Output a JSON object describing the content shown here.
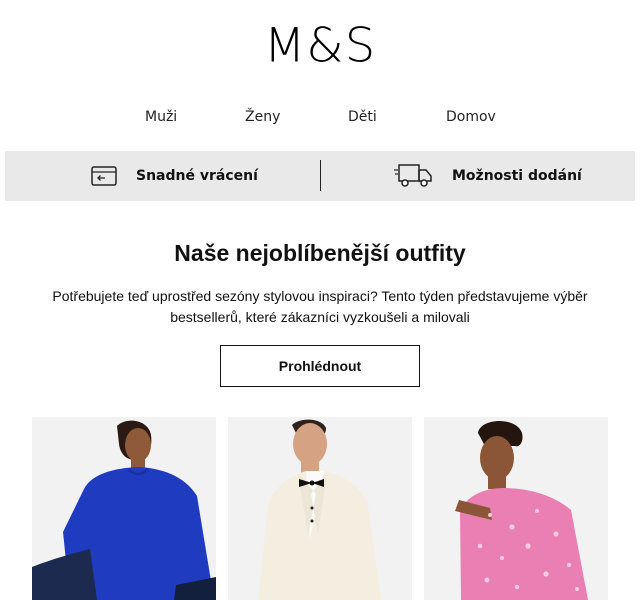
{
  "brand": {
    "logo_text": "M&S"
  },
  "nav": {
    "items": [
      "Muži",
      "Ženy",
      "Děti",
      "Domov"
    ]
  },
  "benefits": {
    "returns_label": "Snadné vrácení",
    "delivery_label": "Možnosti dodání"
  },
  "hero": {
    "title": "Naše nejoblíbenější outfity",
    "body": "Potřebujete teď uprostřed sezóny stylovou inspiraci? Tento týden představujeme výběr bestsellerů, které zákazníci vyzkoušeli a milovali",
    "cta_label": "Prohlédnout"
  },
  "products": [
    {
      "name": "woman-blue-top",
      "colors": {
        "garment": "#1f3bc0",
        "background": "#f2f2f2"
      }
    },
    {
      "name": "man-white-tuxedo",
      "colors": {
        "garment": "#f3eedf",
        "background": "#f2f2f2"
      }
    },
    {
      "name": "woman-pink-floral-dress",
      "colors": {
        "garment": "#e97fb3",
        "background": "#f2f2f2"
      }
    }
  ]
}
